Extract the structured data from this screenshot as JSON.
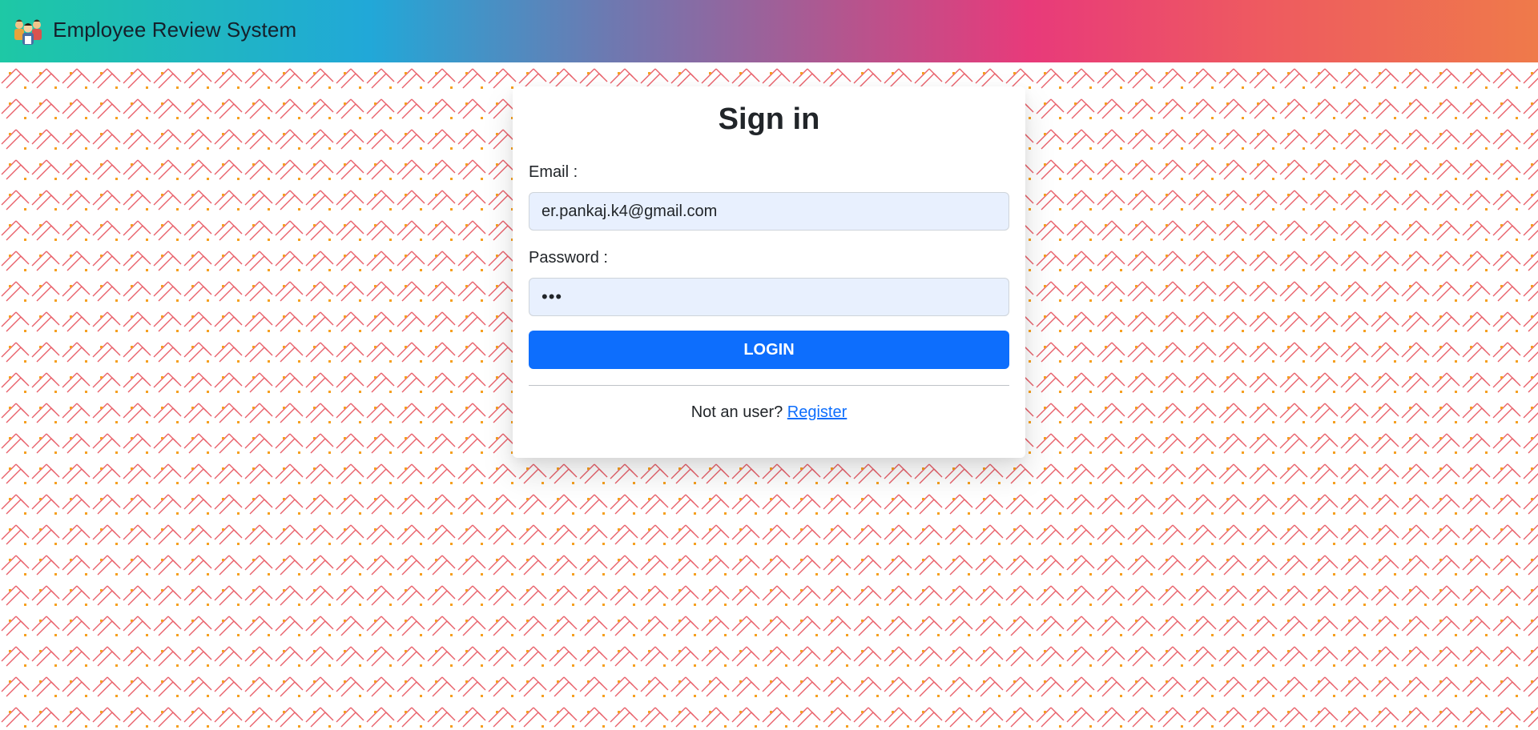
{
  "app": {
    "title": "Employee Review System"
  },
  "login": {
    "heading": "Sign in",
    "email_label": "Email :",
    "email_value": "er.pankaj.k4@gmail.com",
    "password_label": "Password :",
    "password_value": "abc",
    "submit_label": "LOGIN",
    "register_prompt": "Not an user?",
    "register_link": "Register"
  },
  "colors": {
    "accent": "#0d6efd",
    "pattern_line": "#e8606a",
    "pattern_dot": "#f5a020"
  },
  "icons": {
    "logo": "employees-group-icon"
  }
}
